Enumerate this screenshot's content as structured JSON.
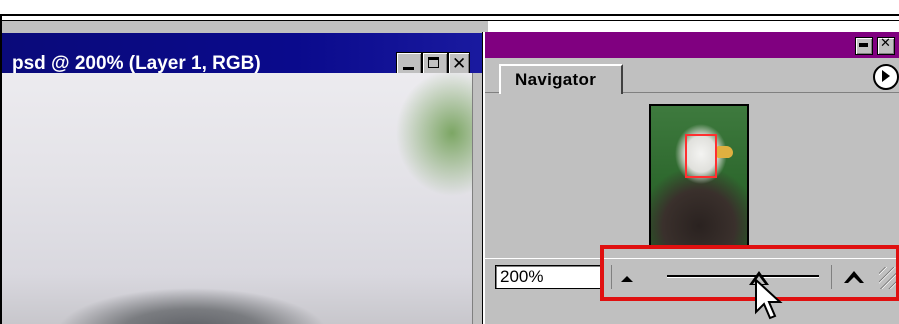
{
  "document_window": {
    "title": "psd @ 200% (Layer 1, RGB)",
    "buttons": [
      "minimize-icon",
      "maximize-icon",
      "close-icon"
    ]
  },
  "navigator": {
    "tab_label": "Navigator",
    "zoom_value": "200%",
    "menu_icon": "triangle-right-icon",
    "zoom_out_icon": "small-mountain-icon",
    "zoom_in_icon": "large-mountain-icon",
    "zoom_level_fraction": 0.6,
    "titlebar_color": "#800080",
    "view_rect_color": "#ff3030"
  },
  "annotation": {
    "highlight_color": "#e01010"
  }
}
